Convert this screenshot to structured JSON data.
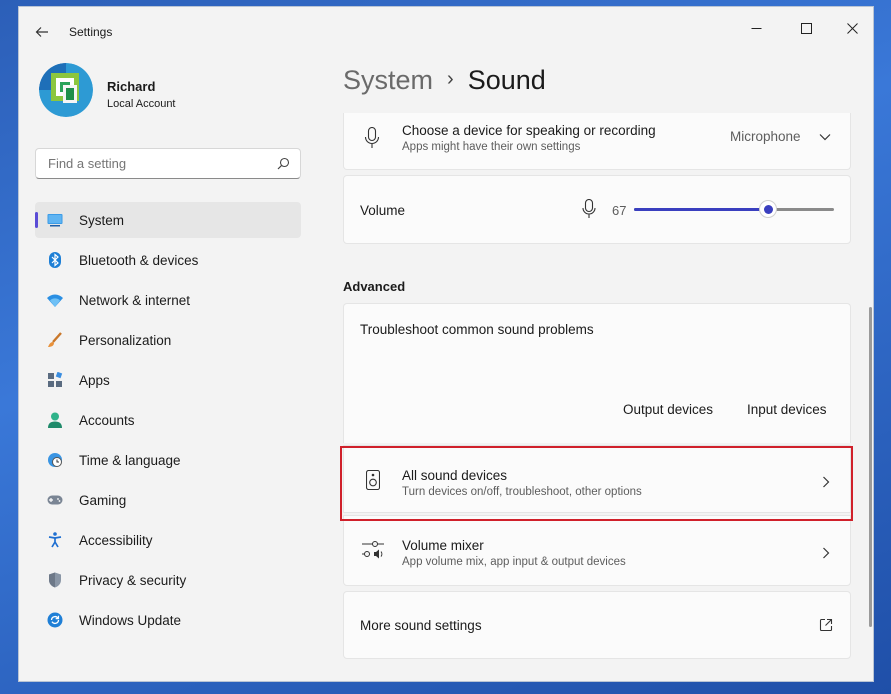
{
  "window": {
    "title": "Settings"
  },
  "profile": {
    "name": "Richard",
    "account_type": "Local Account"
  },
  "search": {
    "placeholder": "Find a setting"
  },
  "nav": {
    "items": [
      {
        "label": "System",
        "icon": "monitor-icon",
        "active": true
      },
      {
        "label": "Bluetooth & devices",
        "icon": "bluetooth-icon"
      },
      {
        "label": "Network & internet",
        "icon": "wifi-icon"
      },
      {
        "label": "Personalization",
        "icon": "brush-icon"
      },
      {
        "label": "Apps",
        "icon": "apps-icon"
      },
      {
        "label": "Accounts",
        "icon": "person-icon"
      },
      {
        "label": "Time & language",
        "icon": "globe-clock-icon"
      },
      {
        "label": "Gaming",
        "icon": "gamepad-icon"
      },
      {
        "label": "Accessibility",
        "icon": "accessibility-icon"
      },
      {
        "label": "Privacy & security",
        "icon": "shield-icon"
      },
      {
        "label": "Windows Update",
        "icon": "update-icon"
      }
    ]
  },
  "breadcrumb": {
    "parent": "System",
    "separator": "›",
    "current": "Sound"
  },
  "input_device": {
    "title": "Choose a device for speaking or recording",
    "subtitle": "Apps might have their own settings",
    "selected": "Microphone"
  },
  "volume": {
    "label": "Volume",
    "value": "67",
    "level_percent": 67
  },
  "advanced": {
    "header": "Advanced",
    "troubleshoot": {
      "title": "Troubleshoot common sound problems",
      "output_link": "Output devices",
      "input_link": "Input devices"
    },
    "all_devices": {
      "title": "All sound devices",
      "subtitle": "Turn devices on/off, troubleshoot, other options"
    },
    "mixer": {
      "title": "Volume mixer",
      "subtitle": "App volume mix, app input & output devices"
    },
    "more": {
      "title": "More sound settings"
    }
  },
  "colors": {
    "accent": "#3a3fbf",
    "highlight": "#d0202a",
    "nav_indicator": "#5a4cd6"
  }
}
